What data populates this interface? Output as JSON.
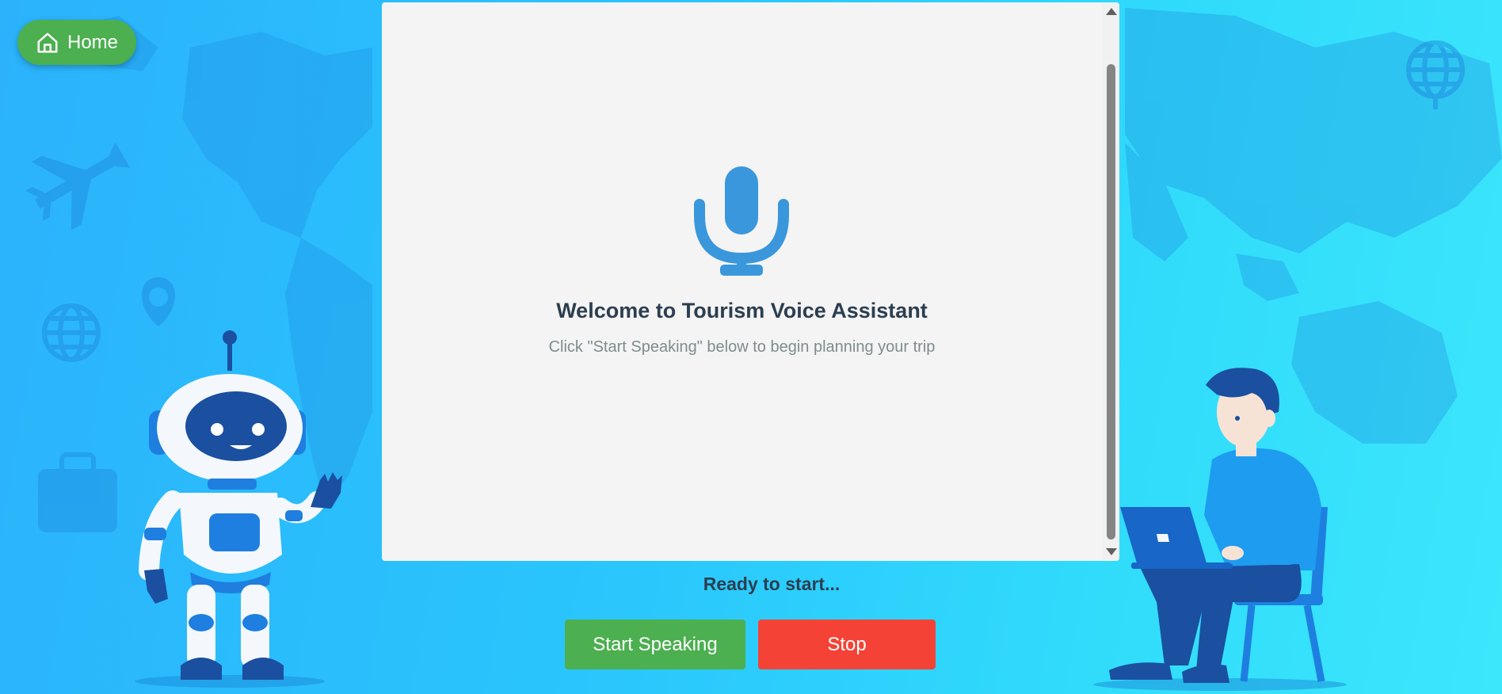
{
  "nav": {
    "home_label": "Home",
    "home_icon": "home-icon"
  },
  "panel": {
    "icon": "microphone-icon",
    "title": "Welcome to Tourism Voice Assistant",
    "subtitle": "Click \"Start Speaking\" below to begin planning your trip"
  },
  "status": {
    "text": "Ready to start..."
  },
  "controls": {
    "start_label": "Start Speaking",
    "stop_label": "Stop"
  },
  "colors": {
    "home_button": "#4caf50",
    "start_button": "#4caf50",
    "stop_button": "#f44336",
    "microphone": "#3a97dc",
    "title_text": "#2c3e50",
    "subtitle_text": "#7f8c8d"
  },
  "decorations": [
    "world-map",
    "airplane-icon",
    "location-pin-icon",
    "globe-icon",
    "suitcase-icon",
    "robot-illustration",
    "person-with-laptop-illustration"
  ]
}
